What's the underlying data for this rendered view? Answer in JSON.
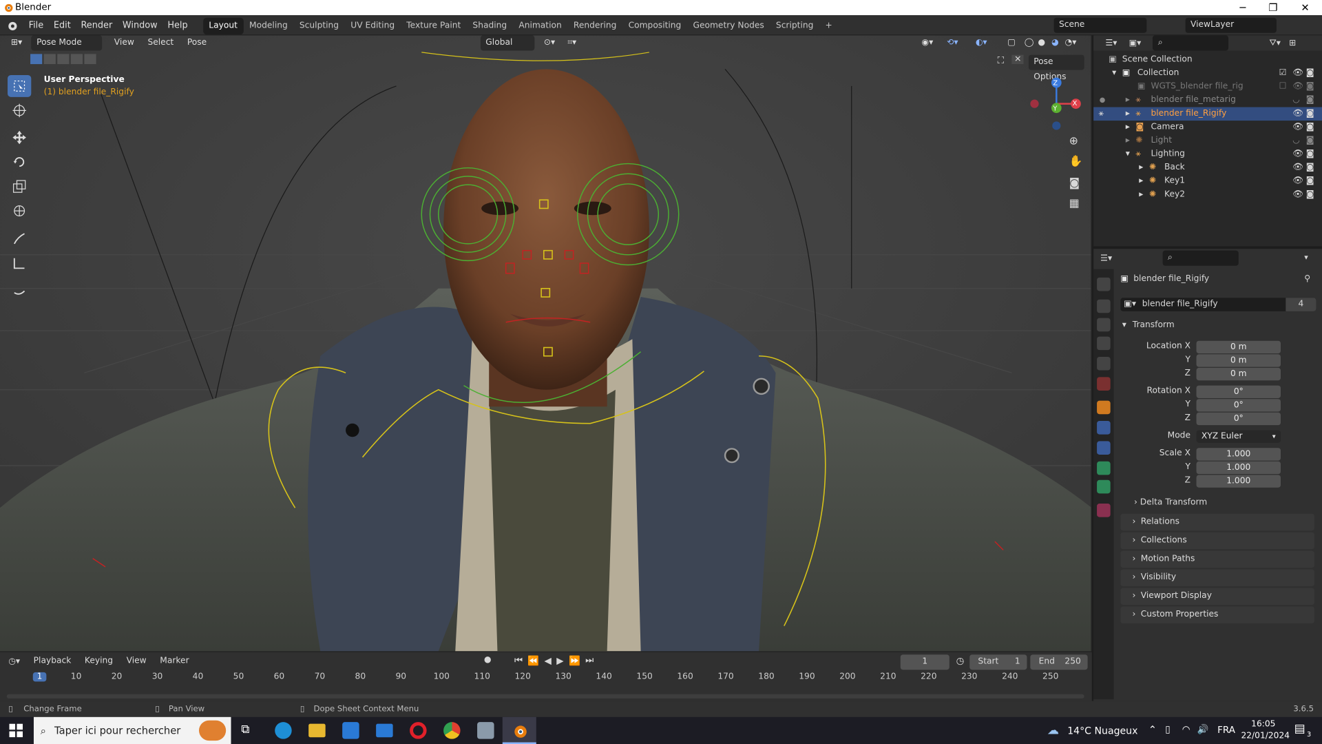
{
  "window": {
    "title": "Blender",
    "minimize": "─",
    "maximize": "❐",
    "close": "✕"
  },
  "menu": [
    "File",
    "Edit",
    "Render",
    "Window",
    "Help"
  ],
  "workspaces": [
    "Layout",
    "Modeling",
    "Sculpting",
    "UV Editing",
    "Texture Paint",
    "Shading",
    "Animation",
    "Rendering",
    "Compositing",
    "Geometry Nodes",
    "Scripting",
    "+"
  ],
  "active_workspace": "Layout",
  "scene": "Scene",
  "view_layer": "ViewLayer",
  "viewport": {
    "mode": "Pose Mode",
    "menus": [
      "View",
      "Select",
      "Pose"
    ],
    "orientation": "Global",
    "pose_options": "Pose Options",
    "perspective": "User Perspective",
    "object_label": "(1) blender file_Rigify",
    "gizmo_x": "X",
    "gizmo_y": "Y",
    "gizmo_z": "Z"
  },
  "outliner": {
    "root": "Scene Collection",
    "items": [
      {
        "label": "Collection"
      },
      {
        "label": "WGTS_blender file_rig"
      },
      {
        "label": "blender file_metarig"
      },
      {
        "label": "blender file_Rigify"
      },
      {
        "label": "Camera"
      },
      {
        "label": "Light"
      },
      {
        "label": "Lighting"
      },
      {
        "label": "Back"
      },
      {
        "label": "Key1"
      },
      {
        "label": "Key2"
      }
    ]
  },
  "properties": {
    "object_name": "blender file_Rigify",
    "datablock_name": "blender file_Rigify",
    "users": "4",
    "transform_title": "Transform",
    "location_x_label": "Location X",
    "location_x": "0 m",
    "location_y_label": "Y",
    "location_y": "0 m",
    "location_z_label": "Z",
    "location_z": "0 m",
    "rotation_x_label": "Rotation X",
    "rotation_x": "0°",
    "rotation_y_label": "Y",
    "rotation_y": "0°",
    "rotation_z_label": "Z",
    "rotation_z": "0°",
    "mode_label": "Mode",
    "mode": "XYZ Euler",
    "scale_x_label": "Scale X",
    "scale_x": "1.000",
    "scale_y_label": "Y",
    "scale_y": "1.000",
    "scale_z_label": "Z",
    "scale_z": "1.000",
    "delta": "Delta Transform",
    "sections": [
      "Relations",
      "Collections",
      "Motion Paths",
      "Visibility",
      "Viewport Display",
      "Custom Properties"
    ]
  },
  "timeline": {
    "menus": [
      "Playback",
      "Keying",
      "View",
      "Marker"
    ],
    "current_frame": "1",
    "start_label": "Start",
    "start": "1",
    "end_label": "End",
    "end": "250",
    "ticks": [
      "1",
      "10",
      "20",
      "30",
      "40",
      "50",
      "60",
      "70",
      "80",
      "90",
      "100",
      "110",
      "120",
      "130",
      "140",
      "150",
      "160",
      "170",
      "180",
      "190",
      "200",
      "210",
      "220",
      "230",
      "240",
      "250"
    ]
  },
  "statusbar": {
    "hint1": "Change Frame",
    "hint2": "Pan View",
    "hint3": "Dope Sheet Context Menu",
    "version": "3.6.5"
  },
  "taskbar": {
    "search": "Taper ici pour rechercher",
    "weather": "14°C  Nuageux",
    "lang": "FRA",
    "time": "16:05",
    "date": "22/01/2024",
    "notif": "3"
  },
  "colors": {
    "accent": "#4772b3",
    "selected_row": "#334d80",
    "rig_green": "#4caf33",
    "rig_yellow": "#d6c21a",
    "rig_red": "#c42222",
    "origin_orange": "#e0a020"
  }
}
